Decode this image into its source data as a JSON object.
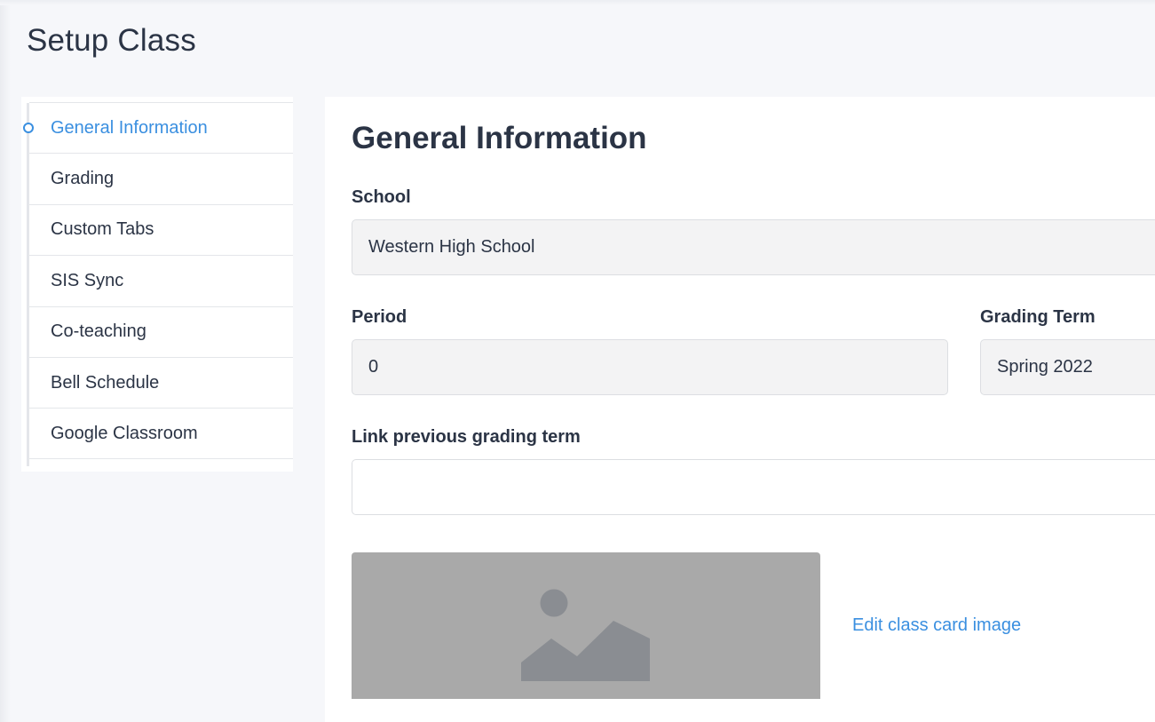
{
  "page": {
    "title": "Setup Class"
  },
  "sidebar": {
    "items": [
      {
        "label": "General Information",
        "active": true
      },
      {
        "label": "Grading"
      },
      {
        "label": "Custom Tabs"
      },
      {
        "label": "SIS Sync"
      },
      {
        "label": "Co-teaching"
      },
      {
        "label": "Bell Schedule"
      },
      {
        "label": "Google Classroom"
      }
    ]
  },
  "main": {
    "section_title": "General Information",
    "school": {
      "label": "School",
      "value": "Western High School"
    },
    "period": {
      "label": "Period",
      "value": "0"
    },
    "grading_term": {
      "label": "Grading Term",
      "value": "Spring 2022"
    },
    "link_previous": {
      "label": "Link previous grading term",
      "value": ""
    },
    "edit_image_label": "Edit class card image"
  },
  "colors": {
    "accent": "#3a8fe0",
    "text": "#2b3445",
    "field_bg": "#f3f3f4",
    "placeholder_bg": "#a9a9a9",
    "placeholder_icon": "#8a8d92"
  },
  "icons": {
    "nav_marker": "circle-marker-icon",
    "image_placeholder": "image-placeholder-icon"
  }
}
